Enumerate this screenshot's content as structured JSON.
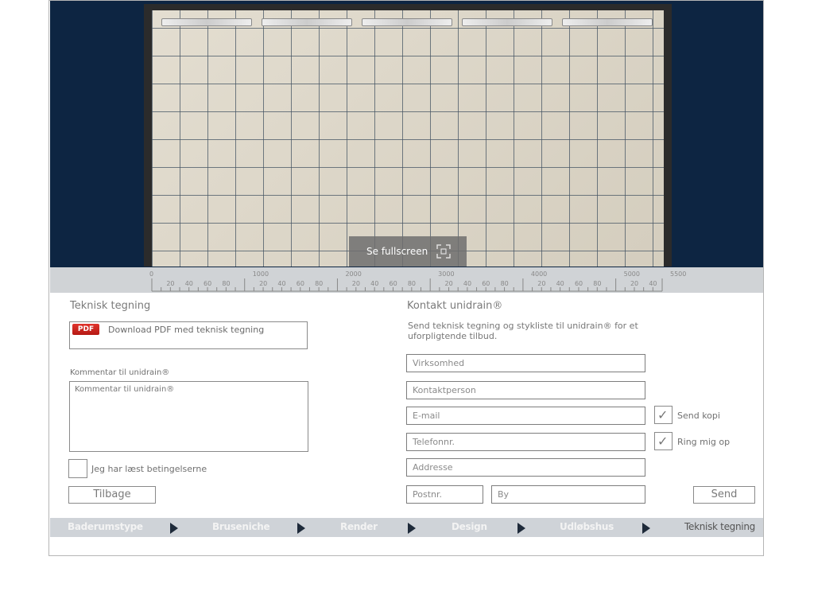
{
  "preview": {
    "fullscreen_label": "Se fullscreen"
  },
  "ruler": {
    "major_labels": [
      "0",
      "1000",
      "2000",
      "3000",
      "4000",
      "5000",
      "5500"
    ],
    "minor_labels": [
      "20",
      "40",
      "60",
      "80"
    ]
  },
  "technical": {
    "title": "Teknisk tegning",
    "pdf_badge": "PDF",
    "pdf_link": "Download PDF med teknisk tegning",
    "comment_label": "Kommentar til unidrain®",
    "comment_placeholder": "Kommentar til unidrain®",
    "terms_label": "Jeg har læst betingelserne",
    "back_button": "Tilbage"
  },
  "contact": {
    "title": "Kontakt unidrain®",
    "description_line1": "Send teknisk tegning og stykliste til unidrain® for et",
    "description_line2": "uforpligtende tilbud.",
    "company_placeholder": "Virksomhed",
    "contact_person_placeholder": "Kontaktperson",
    "email_placeholder": "E-mail",
    "phone_placeholder": "Telefonnr.",
    "address_placeholder": "Addresse",
    "zip_placeholder": "Postnr.",
    "city_placeholder": "By",
    "send_copy_label": "Send kopi",
    "call_me_label": "Ring mig op",
    "send_button": "Send"
  },
  "steps": [
    {
      "label": "Baderumstype"
    },
    {
      "label": "Bruseniche"
    },
    {
      "label": "Render"
    },
    {
      "label": "Design"
    },
    {
      "label": "Udløbshus"
    },
    {
      "label": "Teknisk tegning"
    }
  ]
}
